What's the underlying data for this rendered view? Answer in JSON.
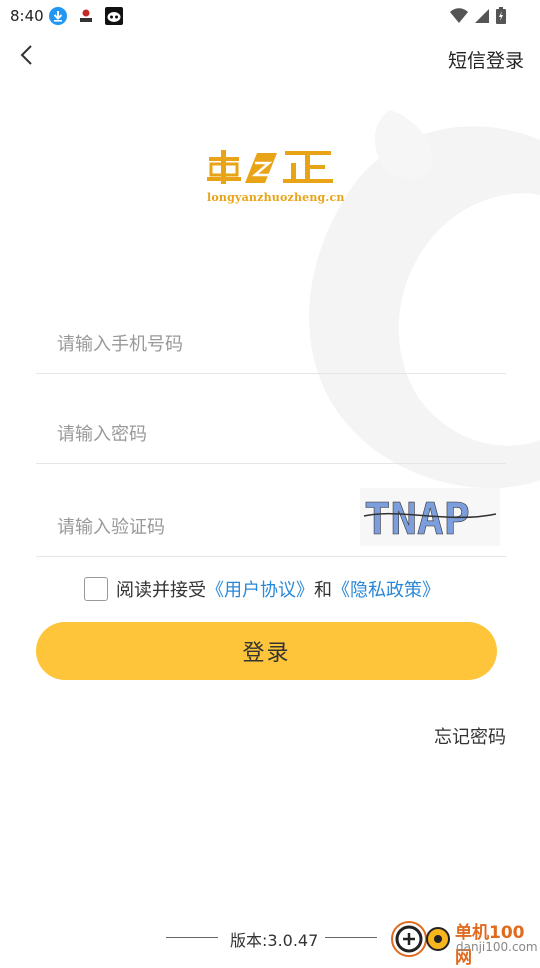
{
  "status_bar": {
    "time": "8:40"
  },
  "header": {
    "back_icon": "chevron-left-icon",
    "sms_login_label": "短信登录"
  },
  "logo": {
    "subtitle": "longyanzhuozheng.cn"
  },
  "form": {
    "phone_placeholder": "请输入手机号码",
    "password_placeholder": "请输入密码",
    "captcha_placeholder": "请输入验证码",
    "captcha_text": "TNAP"
  },
  "agreement": {
    "prefix": "阅读并接受",
    "user_agreement": "《用户协议》",
    "and": "和",
    "privacy_policy": "《隐私政策》"
  },
  "login_button": "登录",
  "forgot_password": "忘记密码",
  "version": "版本:3.0.47",
  "watermark": {
    "title": "单机100网",
    "url": "danji100.com"
  },
  "colors": {
    "accent": "#fec43a",
    "link": "#2a88d8",
    "logo": "#e8a317"
  }
}
